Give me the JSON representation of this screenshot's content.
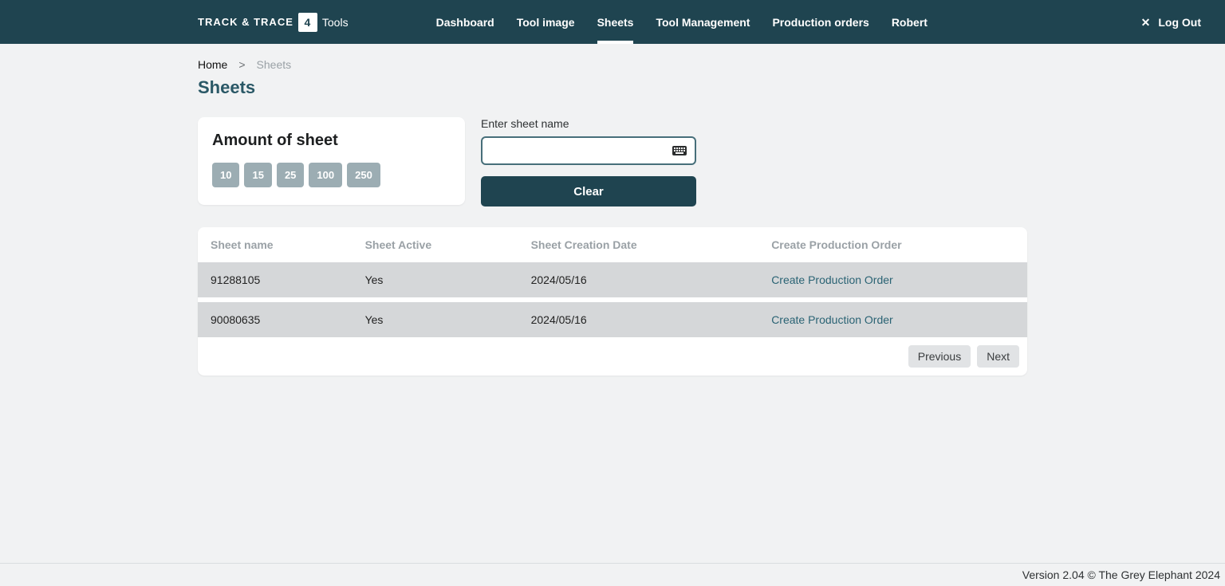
{
  "logo": {
    "left": "TRACK & TRACE",
    "badge": "4",
    "right": "Tools"
  },
  "nav": {
    "items": [
      {
        "label": "Dashboard"
      },
      {
        "label": "Tool image"
      },
      {
        "label": "Sheets",
        "active": true
      },
      {
        "label": "Tool Management"
      },
      {
        "label": "Production orders"
      },
      {
        "label": "Robert"
      }
    ],
    "logout": "Log Out"
  },
  "breadcrumb": {
    "home": "Home",
    "sep": ">",
    "current": "Sheets"
  },
  "page_title": "Sheets",
  "amount_card": {
    "title": "Amount of sheet",
    "options": [
      "10",
      "15",
      "25",
      "100",
      "250"
    ]
  },
  "search": {
    "label": "Enter sheet name",
    "value": "",
    "placeholder": "",
    "clear": "Clear"
  },
  "table": {
    "columns": [
      "Sheet name",
      "Sheet Active",
      "Sheet Creation Date",
      "Create Production Order"
    ],
    "rows": [
      {
        "name": "91288105",
        "active": "Yes",
        "date": "2024/05/16",
        "action": "Create Production Order"
      },
      {
        "name": "90080635",
        "active": "Yes",
        "date": "2024/05/16",
        "action": "Create Production Order"
      }
    ],
    "pager": {
      "prev": "Previous",
      "next": "Next"
    }
  },
  "footer": "Version 2.04 © The Grey Elephant 2024"
}
